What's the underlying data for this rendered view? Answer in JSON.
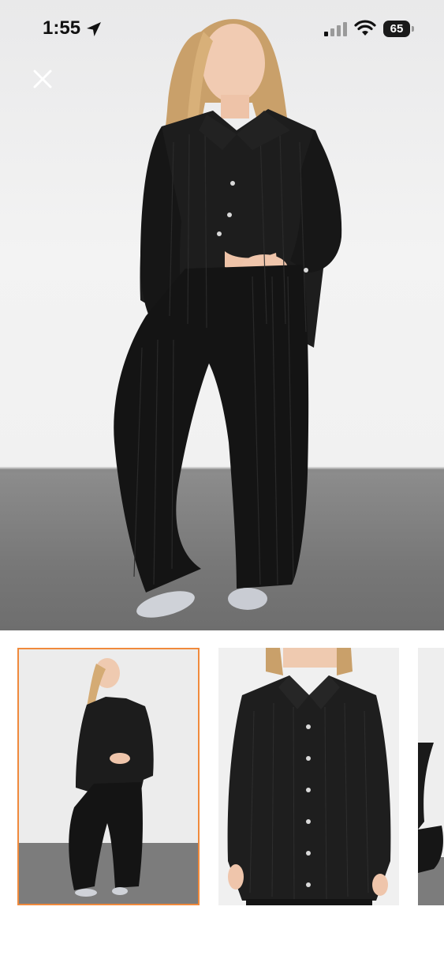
{
  "status_bar": {
    "time": "1:55",
    "battery": "65",
    "icons": [
      "location-arrow-icon",
      "signal-icon",
      "wifi-icon",
      "battery-icon"
    ]
  },
  "viewer": {
    "close_icon": "close-icon",
    "hero_image": "product-photo-black-pleated-shirt-and-pants-set",
    "selected_thumbnail": 1
  },
  "thumbnails": [
    {
      "image": "full-body-outfit-photo",
      "selected": true
    },
    {
      "image": "shirt-closeup-photo",
      "selected": false
    },
    {
      "image": "partial-photo",
      "selected": false
    }
  ],
  "colors": {
    "selected_border": "#f08a3c",
    "garment": "#1b1b1b",
    "wall": "#f1f1f1",
    "floor": "#7b7b7b"
  }
}
